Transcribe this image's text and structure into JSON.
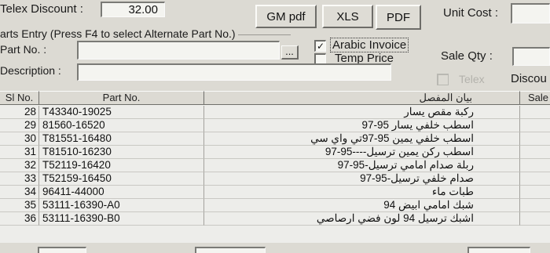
{
  "header": {
    "telex_discount_label": "Telex Discount :",
    "telex_discount_value": "32.00",
    "buttons": {
      "gm_pdf": "GM pdf",
      "xls": "XLS",
      "pdf": "PDF"
    },
    "unit_cost_label": "Unit Cost :",
    "unit_cost_value": "",
    "parts_entry_label": "arts Entry (Press F4 to select Alternate Part No.)",
    "part_no_label": "Part No. :",
    "part_no_value": "",
    "ellipsis_label": "...",
    "arabic_invoice_label": "Arabic Invoice",
    "arabic_invoice_checked": true,
    "temp_price_label": "Temp Price",
    "temp_price_checked": false,
    "sale_qty_label": "Sale Qty :",
    "sale_qty_value": "",
    "description_label": "Description :",
    "description_value": "",
    "telex_check_label": "Telex",
    "telex_checked": false,
    "discount_label": "Discou"
  },
  "grid": {
    "columns": [
      "Sl No.",
      "Part No.",
      "بيان المفصل",
      "Sale"
    ],
    "rows": [
      {
        "sl": "28",
        "part": "T43340-19025",
        "desc": "ركبة مقص يسار"
      },
      {
        "sl": "29",
        "part": "81560-16520",
        "desc": "اسطب خلفي يسار 95-97"
      },
      {
        "sl": "30",
        "part": "T81551-16480",
        "desc": "اسطب خلفي يمين 95-97تي واي سي"
      },
      {
        "sl": "31",
        "part": "T81510-16230",
        "desc": "اسطب ركن يمين ترسيل----95-97"
      },
      {
        "sl": "32",
        "part": "T52119-16420",
        "desc": "ربلة صدام امامي ترسيل-95-97"
      },
      {
        "sl": "33",
        "part": "T52159-16450",
        "desc": "صدام خلفي ترسيل-95-97"
      },
      {
        "sl": "34",
        "part": "96411-44000",
        "desc": "طبات ماء"
      },
      {
        "sl": "35",
        "part": "53111-16390-A0",
        "desc": "شبك امامي ابيض 94"
      },
      {
        "sl": "36",
        "part": "53111-16390-B0",
        "desc": "اشبك ترسيل 94 لون فضي ارصاصي"
      }
    ]
  }
}
